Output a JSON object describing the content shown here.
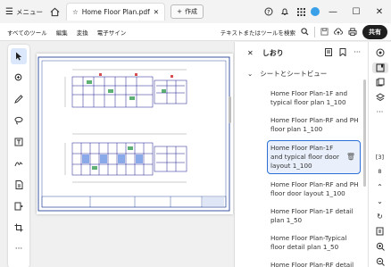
{
  "titlebar": {
    "menu_label": "メニュー",
    "tab_title": "Home Floor Plan.pdf",
    "new_tab_label": "作成"
  },
  "toolbar": {
    "menu": [
      "すべてのツール",
      "編集",
      "変換",
      "電子サイン"
    ],
    "search_label": "テキストまたはツールを検索",
    "share_label": "共有"
  },
  "bookmarks": {
    "title": "しおり",
    "section_label": "シートとシートビュー",
    "items": [
      "Home Floor Plan-1F and typical floor plan 1_100",
      "Home Floor Plan-RF and PH floor plan 1_100",
      "Home Floor Plan-1F and typical floor door layout 1_100",
      "Home Floor Plan-RF and PH floor door layout 1_100",
      "Home Floor Plan-1F detail plan 1_50",
      "Home Floor Plan-Typical floor detail plan 1_50",
      "Home Floor Plan-RF detail"
    ],
    "selected_index": 2
  },
  "rightbar": {
    "page_number": "[3]",
    "page_count": "8"
  },
  "icons": {
    "accent": "#2b6fd6"
  }
}
